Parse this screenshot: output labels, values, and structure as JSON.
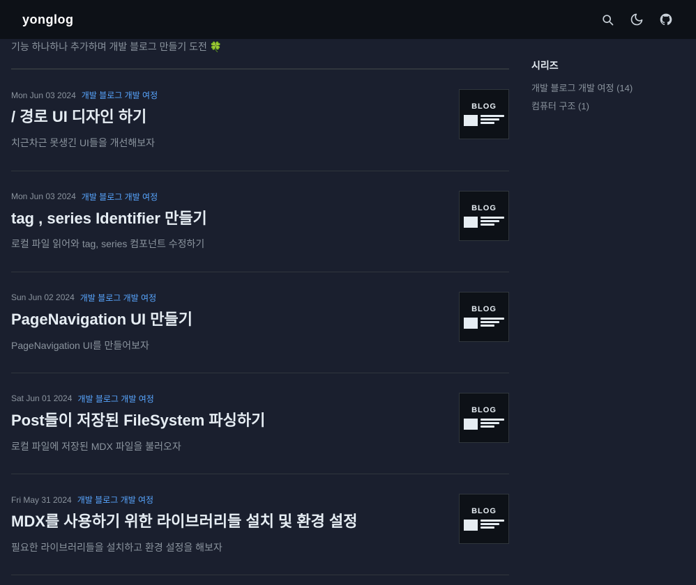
{
  "header": {
    "logo": "yonglog",
    "search_label": "Search",
    "theme_label": "Toggle theme",
    "github_label": "GitHub"
  },
  "sidebar": {
    "section_title": "시리즈",
    "items": [
      {
        "label": "개발 블로그 개발 여정",
        "count": 14,
        "display": "개발 블로그 개발 여정 (14)"
      },
      {
        "label": "컴퓨터 구조",
        "count": 1,
        "display": "컴퓨터 구조 (1)"
      }
    ]
  },
  "posts": [
    {
      "date": "Mon Jun 03 2024",
      "tags": [
        "개발 블로그 개발 여정"
      ],
      "title": "/ 경로 UI 디자인 하기",
      "description": "치근차근 못생긴 UI들을 개선해보자",
      "description_link_text": "개선해보자",
      "thumb_label": "BLOG"
    },
    {
      "date": "Mon Jun 03 2024",
      "tags": [
        "개발 블로그 개발 여정"
      ],
      "title": "tag , series Identifier 만들기",
      "description": "로컬 파일 읽어와 tag, series 컴포넌트 수정하기",
      "description_link_text": null,
      "thumb_label": "BLOG"
    },
    {
      "date": "Sun Jun 02 2024",
      "tags": [
        "개발 블로그 개발 여정"
      ],
      "title": "PageNavigation UI 만들기",
      "description": "PageNavigation UI를 만들어보자",
      "description_link_text": null,
      "thumb_label": "BLOG"
    },
    {
      "date": "Sat Jun 01 2024",
      "tags": [
        "개발 블로그 개발 여정"
      ],
      "title": "Post들이 저장된 FileSystem 파싱하기",
      "description": "로컬 파일에 저장된 MDX 파일을 불러오자",
      "description_link_text": null,
      "thumb_label": "BLOG"
    },
    {
      "date": "Fri May 31 2024",
      "tags": [
        "개발 블로그 개발 여정"
      ],
      "title": "MDX를 사용하기 위한 라이브러리들 설치 및 환경 설정",
      "description": "필요한 라이브러리들을 설치하고 환경 설정을 해보자",
      "description_link_text": null,
      "thumb_label": "BLOG"
    }
  ]
}
